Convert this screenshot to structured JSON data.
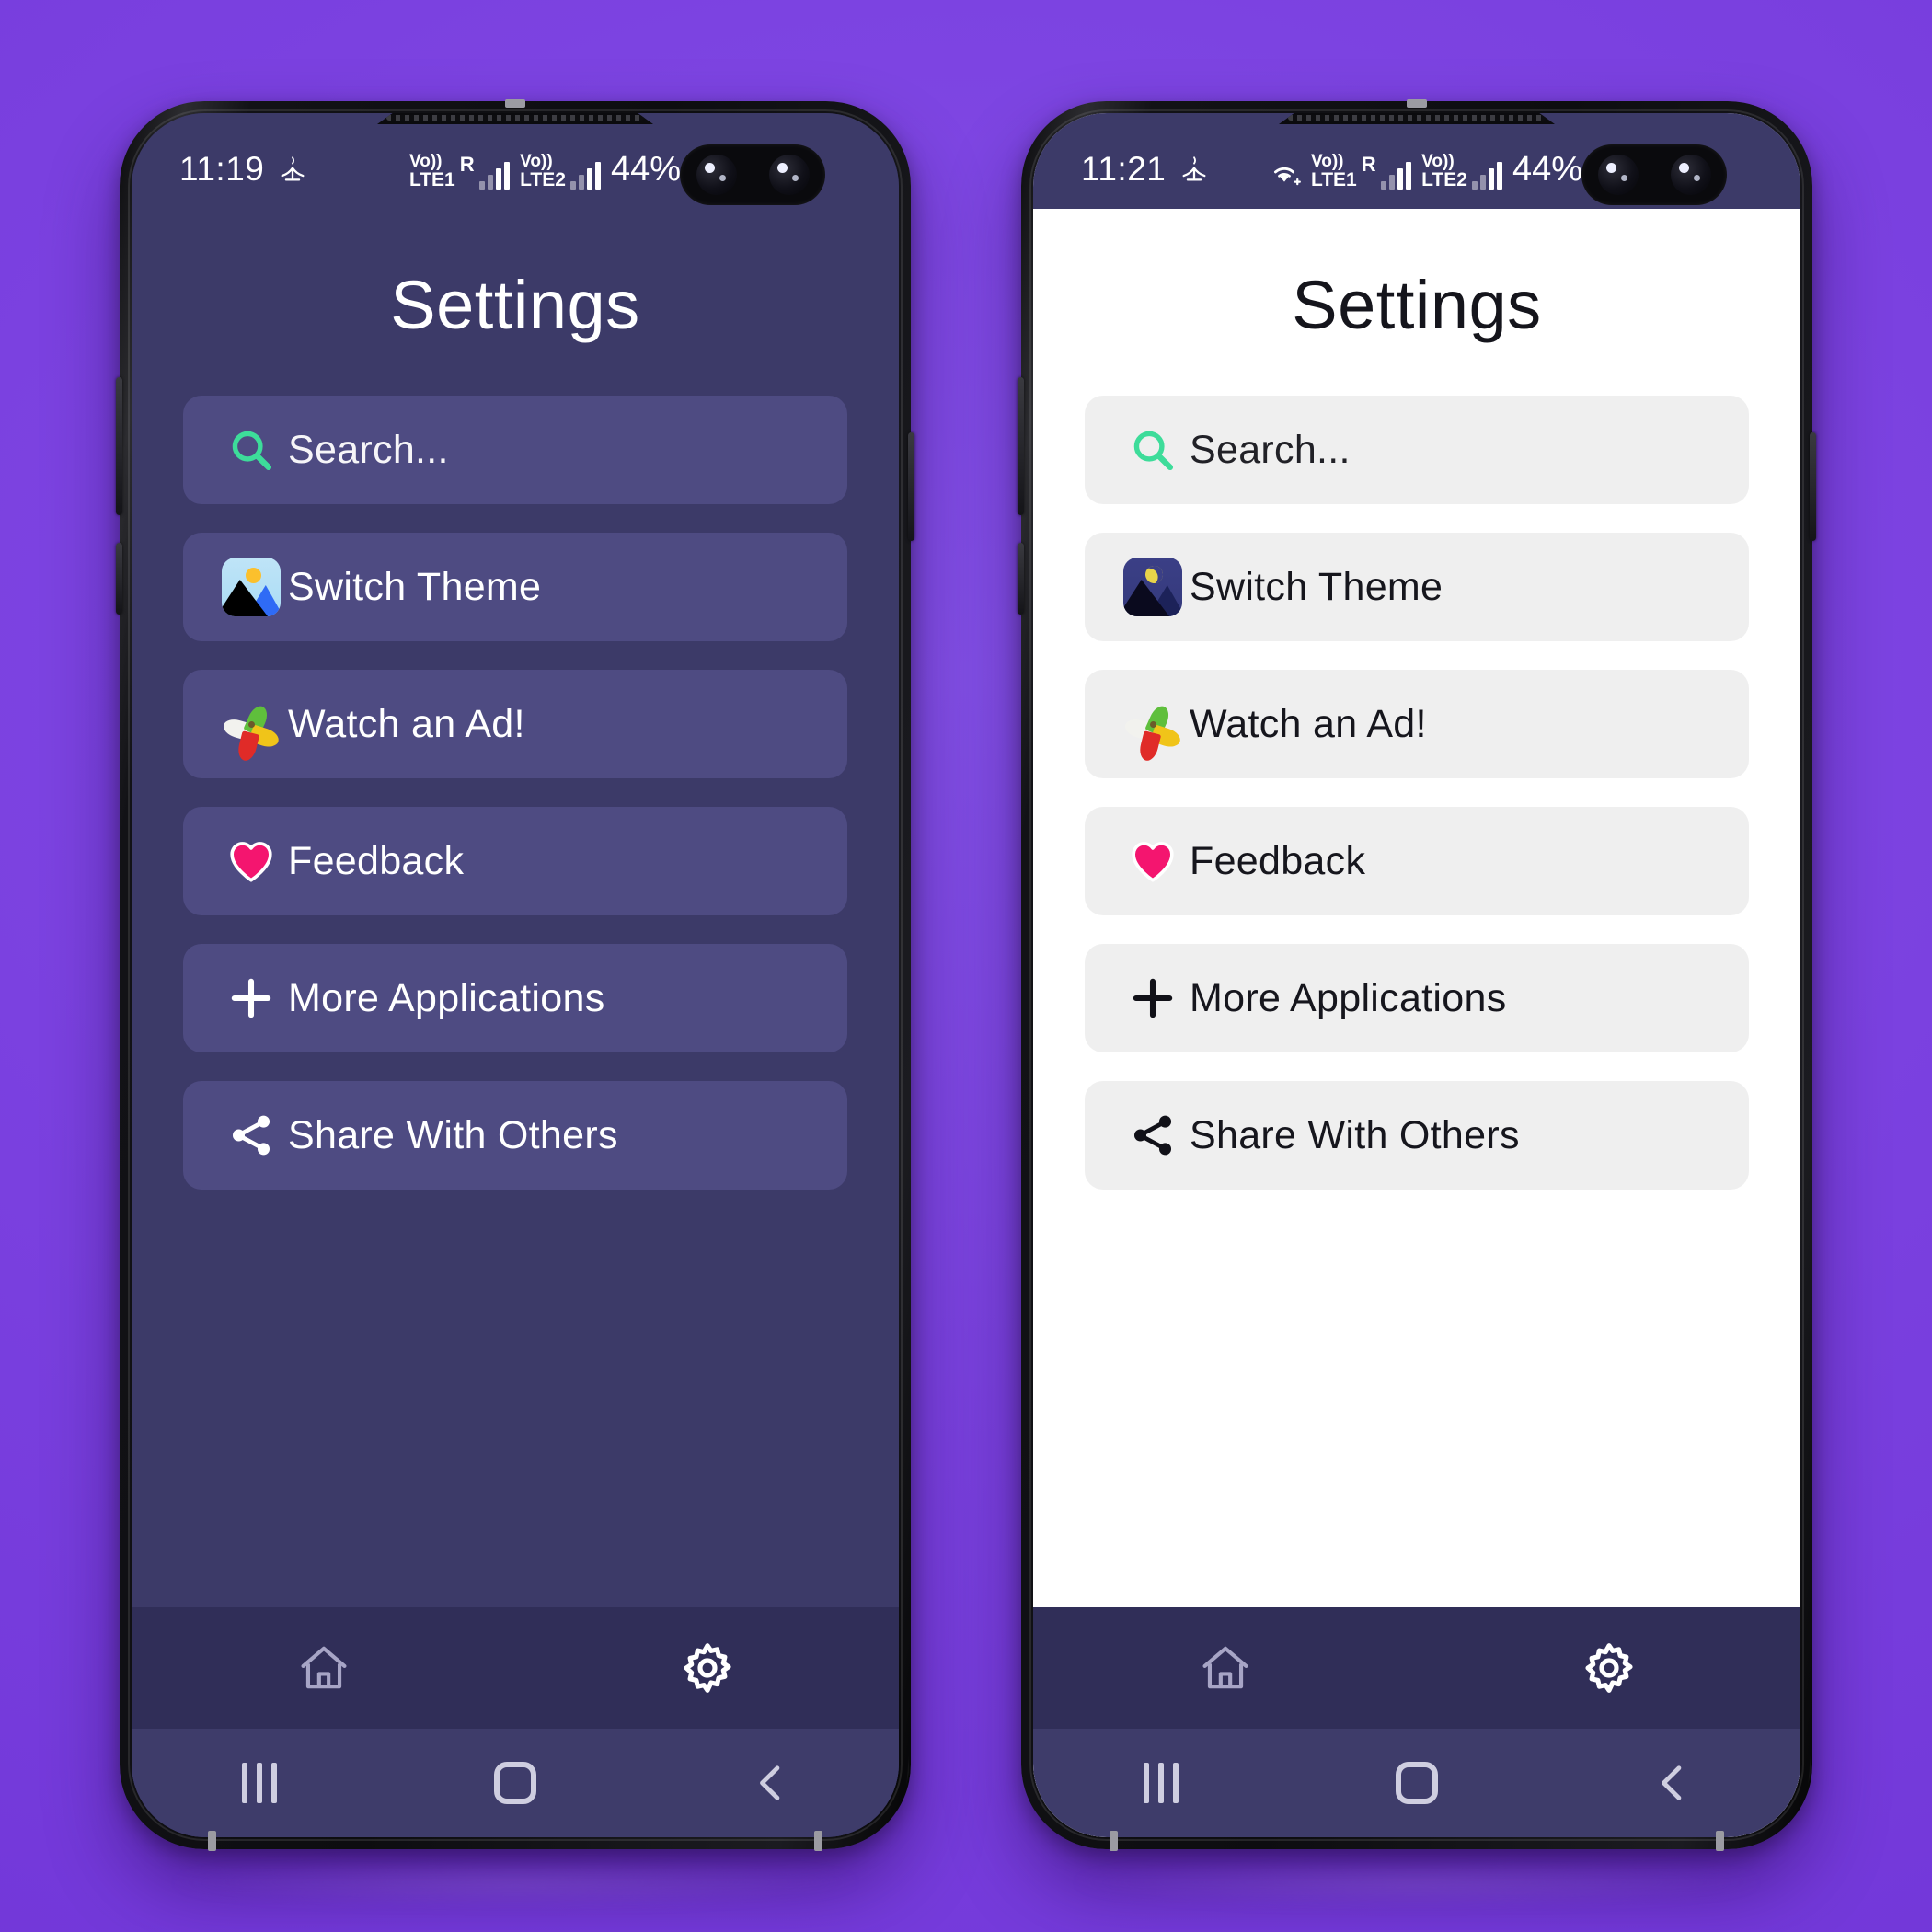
{
  "background_color": "#7b41e0",
  "phones": [
    {
      "id": "left-phone-dark-theme",
      "theme": "dark",
      "screen_bg": "#3c3a68",
      "row_bg": "#4e4b82",
      "statusbar": {
        "time": "11:19",
        "airplane_like_icon": "no-sim-cross-icon",
        "wifi": false,
        "sim1_volte": "Vo))",
        "sim1_label": "LTE1",
        "roaming": "R",
        "sim2_volte": "Vo))",
        "sim2_label": "LTE2",
        "battery_percent": "44%"
      },
      "title": "Settings",
      "rows": [
        {
          "icon": "search-icon",
          "label": "Search...",
          "icon_color": "#3ddc9a"
        },
        {
          "icon": "theme-image-icon",
          "label": "Switch Theme",
          "variant": "day"
        },
        {
          "icon": "pinwheel-ad-icon",
          "label": "Watch an Ad!"
        },
        {
          "icon": "heart-icon",
          "label": "Feedback",
          "icon_color": "#f4156f"
        },
        {
          "icon": "plus-icon",
          "label": "More Applications",
          "icon_color": "#ffffff"
        },
        {
          "icon": "share-icon",
          "label": "Share With Others",
          "icon_color": "#ffffff"
        }
      ],
      "appnav": [
        {
          "icon": "home-icon",
          "active": false
        },
        {
          "icon": "gear-icon",
          "active": true
        }
      ],
      "sysnav": [
        {
          "icon": "recents-icon"
        },
        {
          "icon": "home-square-icon"
        },
        {
          "icon": "back-icon"
        }
      ]
    },
    {
      "id": "right-phone-light-theme",
      "theme": "light",
      "screen_bg": "#ffffff",
      "row_bg": "#efefef",
      "statusbar": {
        "time": "11:21",
        "airplane_like_icon": "no-sim-cross-icon",
        "wifi": true,
        "sim1_volte": "Vo))",
        "sim1_label": "LTE1",
        "roaming": "R",
        "sim2_volte": "Vo))",
        "sim2_label": "LTE2",
        "battery_percent": "44%"
      },
      "title": "Settings",
      "rows": [
        {
          "icon": "search-icon",
          "label": "Search...",
          "icon_color": "#3ddc9a"
        },
        {
          "icon": "theme-image-icon",
          "label": "Switch Theme",
          "variant": "night"
        },
        {
          "icon": "pinwheel-ad-icon",
          "label": "Watch an Ad!"
        },
        {
          "icon": "heart-icon",
          "label": "Feedback",
          "icon_color": "#f4156f"
        },
        {
          "icon": "plus-icon",
          "label": "More Applications",
          "icon_color": "#111118"
        },
        {
          "icon": "share-icon",
          "label": "Share With Others",
          "icon_color": "#111118"
        }
      ],
      "appnav": [
        {
          "icon": "home-icon",
          "active": false
        },
        {
          "icon": "gear-icon",
          "active": true
        }
      ],
      "sysnav": [
        {
          "icon": "recents-icon"
        },
        {
          "icon": "home-square-icon"
        },
        {
          "icon": "back-icon"
        }
      ]
    }
  ]
}
